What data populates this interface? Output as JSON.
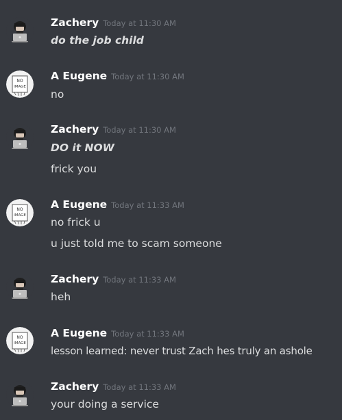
{
  "messages": [
    {
      "author": "Zachery",
      "avatar": "zach-avatar-icon",
      "timestamp": "Today at 11:30 AM",
      "lines": [
        {
          "text": "do the job child",
          "style": "bold-italic"
        }
      ]
    },
    {
      "author": "A Eugene",
      "avatar": "no-image-avatar-icon",
      "timestamp": "Today at 11:30 AM",
      "lines": [
        {
          "text": "no",
          "style": "normal"
        }
      ]
    },
    {
      "author": "Zachery",
      "avatar": "zach-avatar-icon",
      "timestamp": "Today at 11:30 AM",
      "lines": [
        {
          "text": "DO it NOW",
          "style": "bold-italic"
        },
        {
          "text": "frick you",
          "style": "normal"
        }
      ]
    },
    {
      "author": "A Eugene",
      "avatar": "no-image-avatar-icon",
      "timestamp": "Today at 11:33 AM",
      "lines": [
        {
          "text": "no frick u",
          "style": "normal"
        },
        {
          "text": "u just told me to scam someone",
          "style": "normal"
        }
      ]
    },
    {
      "author": "Zachery",
      "avatar": "zach-avatar-icon",
      "timestamp": "Today at 11:33 AM",
      "lines": [
        {
          "text": "heh",
          "style": "normal"
        }
      ]
    },
    {
      "author": "A Eugene",
      "avatar": "no-image-avatar-icon",
      "timestamp": "Today at 11:33 AM",
      "lines": [
        {
          "text": "lesson learned: never trust Zach hes truly an ashole",
          "style": "normal"
        }
      ]
    },
    {
      "author": "Zachery",
      "avatar": "zach-avatar-icon",
      "timestamp": "Today at 11:33 AM",
      "lines": [
        {
          "text": "your doing a service",
          "style": "normal"
        }
      ]
    }
  ],
  "no_image_text": [
    "NO",
    "IMAGE"
  ],
  "colors": {
    "background": "#36393f",
    "username": "#ffffff",
    "timestamp": "#72767d",
    "message_text": "#dcddde"
  }
}
